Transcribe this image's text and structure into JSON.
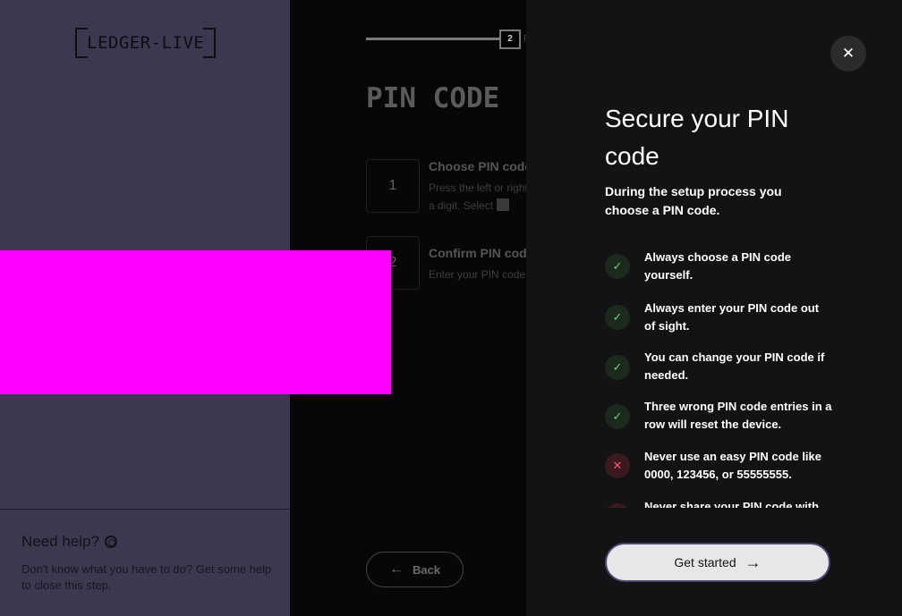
{
  "sidebar": {
    "logo_text": "LEDGER-LIVE",
    "help_title": "Need help?",
    "help_text": "Don't know what you have to do? Get some help to close this step."
  },
  "step": {
    "progress_badge": "2",
    "progress_label": "P",
    "title": "PIN CODE",
    "items": [
      {
        "number": "1",
        "heading": "Choose PIN code",
        "desc_line1": "Press the left or right button to change",
        "desc_line2": "a digit. Select"
      },
      {
        "number": "2",
        "heading": "Confirm PIN code",
        "desc_line1": "Enter your PIN code again"
      }
    ],
    "back_label": "Back"
  },
  "drawer": {
    "title": "Secure your PIN code",
    "subtitle": "During the setup process you choose a PIN code.",
    "tips": [
      {
        "type": "ok",
        "text": "Always choose a PIN code yourself."
      },
      {
        "type": "ok",
        "text": "Always enter your PIN code out of sight."
      },
      {
        "type": "ok",
        "text": "You can change your PIN code if needed."
      },
      {
        "type": "ok",
        "text": "Three wrong PIN code entries in a row will reset the device."
      },
      {
        "type": "bad",
        "text": "Never use an easy PIN code like 0000, 123456, or 55555555."
      },
      {
        "type": "bad",
        "text": "Never share your PIN code with"
      }
    ],
    "cta_label": "Get started"
  },
  "icons": {
    "close": "close-icon",
    "check": "check-icon",
    "cross": "cross-icon",
    "arrow_left": "arrow-left-icon",
    "arrow_right": "arrow-right-icon",
    "lifebuoy": "lifebuoy-icon"
  },
  "colors": {
    "sidebar_bg": "#3c3850",
    "drawer_bg": "#131315",
    "ok": "#6fcf75",
    "bad": "#f0586a",
    "redaction": "#ff00ff"
  }
}
